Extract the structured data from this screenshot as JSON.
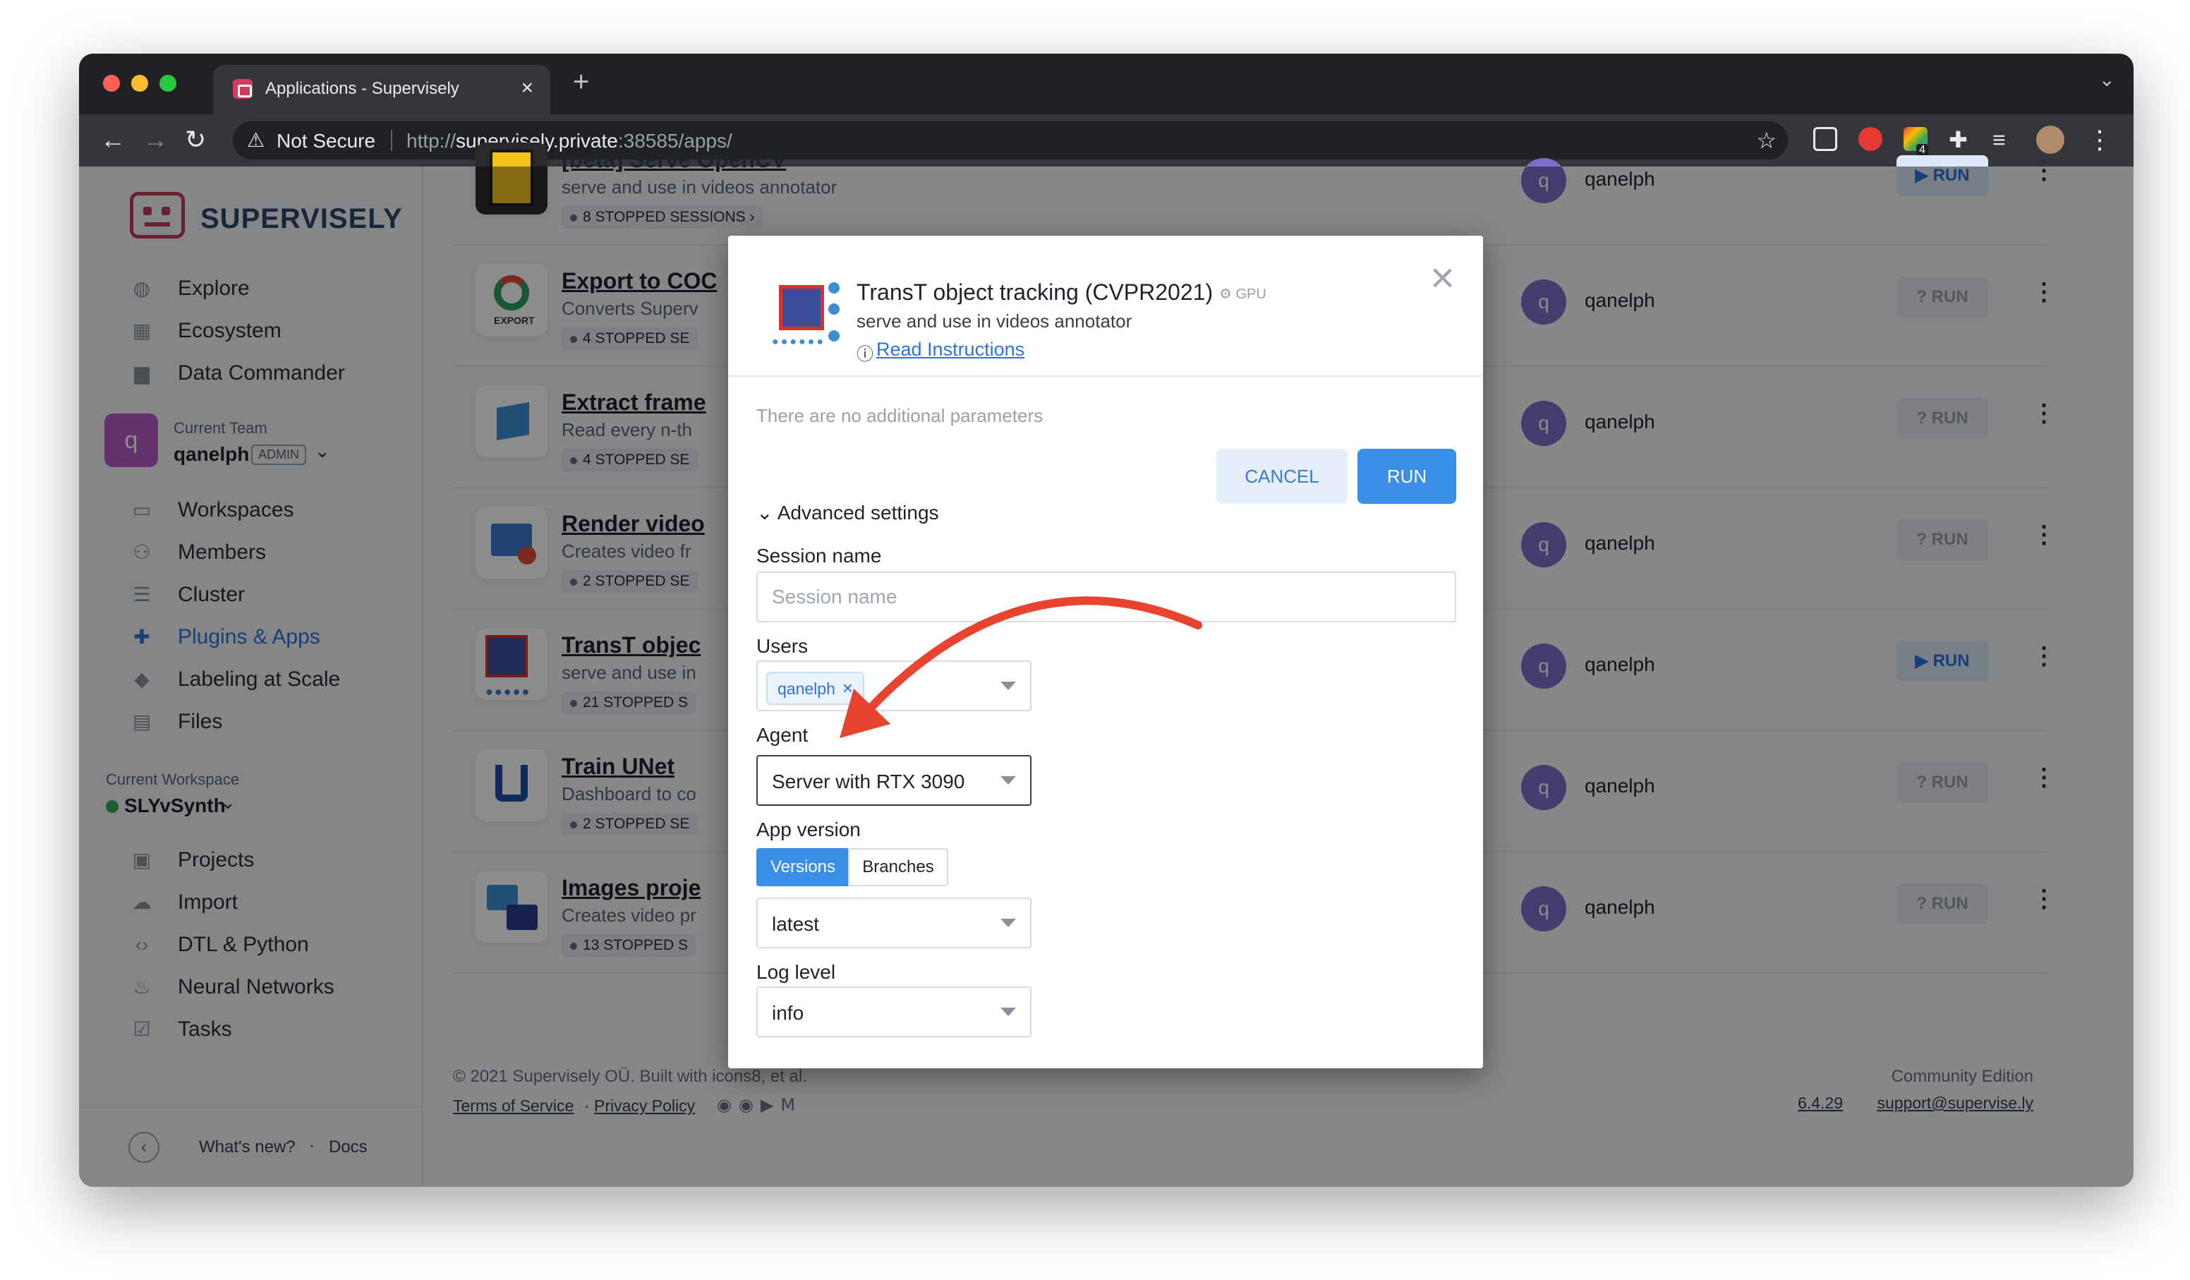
{
  "browser": {
    "tab_title": "Applications - Supervisely",
    "tab_close": "×",
    "new_tab": "+",
    "not_secure": "Not Secure",
    "url_prefix": "http://",
    "url_host": "supervisely.private",
    "url_rest": ":38585/apps/",
    "ext_badge": "4"
  },
  "sidebar": {
    "brand": "SUPERVISELY",
    "top_items": [
      {
        "label": "Explore",
        "icon": "globe-icon"
      },
      {
        "label": "Ecosystem",
        "icon": "grid-icon"
      },
      {
        "label": "Data Commander",
        "icon": "folder-icon"
      }
    ],
    "team": {
      "caption": "Current Team",
      "avatar_letter": "q",
      "name": "qanelph",
      "role": "ADMIN"
    },
    "team_items": [
      {
        "label": "Workspaces",
        "icon": "monitor-icon"
      },
      {
        "label": "Members",
        "icon": "people-icon"
      },
      {
        "label": "Cluster",
        "icon": "list-icon"
      },
      {
        "label": "Plugins & Apps",
        "icon": "puzzle-icon",
        "active": true
      },
      {
        "label": "Labeling at Scale",
        "icon": "mortarboard-icon"
      },
      {
        "label": "Files",
        "icon": "file-icon"
      }
    ],
    "workspace": {
      "caption": "Current Workspace",
      "name": "SLYvSynth",
      "status_color": "#3aa757"
    },
    "workspace_items": [
      {
        "label": "Projects",
        "icon": "images-icon"
      },
      {
        "label": "Import",
        "icon": "cloud-upload-icon"
      },
      {
        "label": "DTL & Python",
        "icon": "code-icon"
      },
      {
        "label": "Neural Networks",
        "icon": "flame-icon"
      },
      {
        "label": "Tasks",
        "icon": "checklist-icon"
      }
    ],
    "footer": {
      "whats_new": "What's new?",
      "separator": "·",
      "docs": "Docs"
    }
  },
  "apps": [
    {
      "title": "[beta] Serve OpenCV",
      "desc": "serve and use in videos annotator",
      "sessions": "8 STOPPED SESSIONS ›",
      "owner": "qanelph",
      "run": "RUN",
      "run_enabled": true
    },
    {
      "title": "Export to COC",
      "desc": "Converts Superv",
      "sessions": "4 STOPPED SE",
      "owner": "qanelph",
      "run": "RUN",
      "run_enabled": false
    },
    {
      "title": "Extract frame",
      "desc": "Read every n-th",
      "sessions": "4 STOPPED SE",
      "owner": "qanelph",
      "run": "RUN",
      "run_enabled": false
    },
    {
      "title": "Render video",
      "desc": "Creates video fr",
      "sessions": "2 STOPPED SE",
      "owner": "qanelph",
      "run": "RUN",
      "run_enabled": false
    },
    {
      "title": "TransT objec",
      "desc": "serve and use in",
      "sessions": "21 STOPPED S",
      "owner": "qanelph",
      "run": "RUN",
      "run_enabled": true
    },
    {
      "title": "Train UNet",
      "desc": "Dashboard to co",
      "sessions": "2 STOPPED SE",
      "owner": "qanelph",
      "run": "RUN",
      "run_enabled": false
    },
    {
      "title": "Images proje",
      "desc": "Creates video pr",
      "sessions": "13 STOPPED S",
      "owner": "qanelph",
      "run": "RUN",
      "run_enabled": false
    }
  ],
  "page_footer": {
    "copyright": "© 2021 Supervisely OÜ. Built with icons8, et al.",
    "terms": "Terms of Service",
    "dot": "·",
    "privacy": "Privacy Policy",
    "edition": "Community Edition",
    "version": "6.4.29",
    "support": "support@supervise.ly"
  },
  "modal": {
    "title": "TransT object tracking (CVPR2021)",
    "gpu": "GPU",
    "desc": "serve and use in videos annotator",
    "read_instructions": "Read Instructions",
    "no_params": "There are no additional parameters",
    "cancel": "CANCEL",
    "run": "RUN",
    "advanced": "Advanced settings",
    "session_name_label": "Session name",
    "session_name_placeholder": "Session name",
    "users_label": "Users",
    "user_chip": "qanelph",
    "agent_label": "Agent",
    "agent_value": "Server with RTX 3090",
    "app_version_label": "App version",
    "version_tabs": [
      "Versions",
      "Branches"
    ],
    "version_value": "latest",
    "log_level_label": "Log level",
    "log_level_value": "info"
  },
  "colors": {
    "accent": "#3a8ee6",
    "brand": "#c33a5c",
    "annotation_arrow": "#e8432e"
  }
}
